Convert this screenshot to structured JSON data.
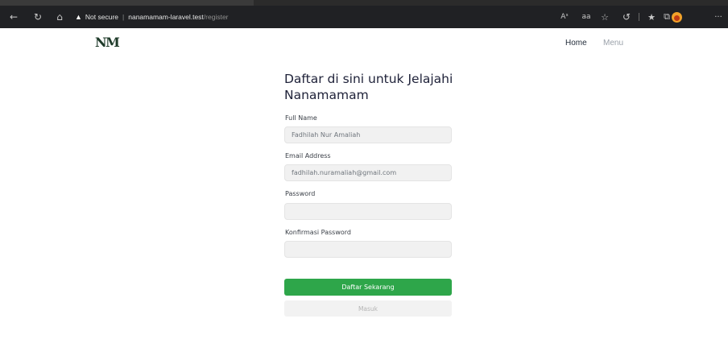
{
  "browser": {
    "address_warning": "Not secure",
    "address_separator": "|",
    "address_host": "nanamamam-laravel.test",
    "address_path": "/register",
    "nav_icons": [
      "back-icon",
      "refresh-icon",
      "home-icon"
    ],
    "right_icons": [
      "read-aloud-icon",
      "translate-icon",
      "favorites-add-icon",
      "extensions-icon",
      "favorites-icon",
      "collections-icon",
      "profile-icon",
      "more-icon"
    ],
    "right_icon_labels": {
      "read_aloud": "Aˢ",
      "translate": "aа"
    }
  },
  "header": {
    "logo": "NM",
    "nav": {
      "home": "Home",
      "menu": "Menu"
    }
  },
  "form": {
    "title": "Daftar di sini untuk Jelajahi Nanamamam",
    "fields": {
      "full_name": {
        "label": "Full Name",
        "value": "Fadhilah Nur Amaliah"
      },
      "email": {
        "label": "Email Address",
        "value": "fadhilah.nuramaliah@gmail.com"
      },
      "password": {
        "label": "Password",
        "value": ""
      },
      "confirm_password": {
        "label": "Konfirmasi Password",
        "value": ""
      }
    },
    "submit_label": "Daftar Sekarang",
    "login_label": "Masuk"
  },
  "colors": {
    "primary_button": "#2ea64a",
    "title_text": "#20233a",
    "logo": "#1f3b2a"
  }
}
